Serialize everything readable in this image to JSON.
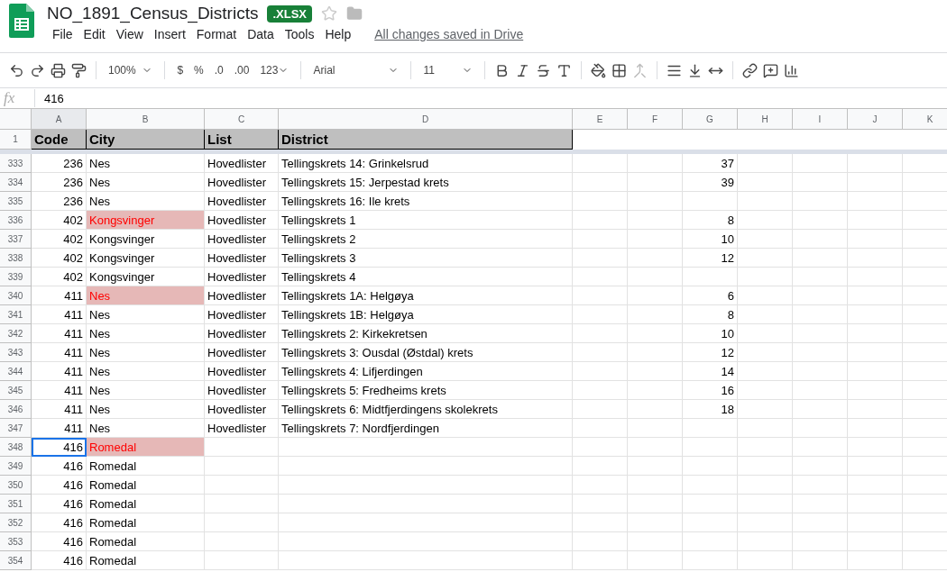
{
  "document": {
    "title": "NO_1891_Census_Districts",
    "badge": ".XLSX",
    "starred": false
  },
  "menu": [
    "File",
    "Edit",
    "View",
    "Insert",
    "Format",
    "Data",
    "Tools",
    "Help"
  ],
  "save_status": "All changes saved in Drive",
  "toolbar": {
    "zoom": "100%",
    "currency": "$",
    "percent": "%",
    "decrease_decimals": ".0",
    "increase_decimals": ".00",
    "number_format": "123",
    "font": "Arial",
    "font_size": "11"
  },
  "formula_bar": {
    "label": "fx",
    "value": "416"
  },
  "columns": [
    {
      "label": "A",
      "selected": true
    },
    {
      "label": "B",
      "selected": false
    },
    {
      "label": "C",
      "selected": false
    },
    {
      "label": "D",
      "selected": false
    },
    {
      "label": "E",
      "selected": false
    },
    {
      "label": "F",
      "selected": false
    },
    {
      "label": "G",
      "selected": false
    },
    {
      "label": "H",
      "selected": false
    },
    {
      "label": "I",
      "selected": false
    },
    {
      "label": "J",
      "selected": false
    },
    {
      "label": "K",
      "selected": false
    }
  ],
  "header_row": {
    "number": "1",
    "cells": [
      "Code",
      "City",
      "List",
      "District"
    ]
  },
  "rows": [
    {
      "number": "333",
      "code": "236",
      "city": "Nes",
      "list": "Hovedlister",
      "district": "Tellingskrets 14: Grinkelsrud",
      "column_g": "37",
      "highlighted": false,
      "selected": false
    },
    {
      "number": "334",
      "code": "236",
      "city": "Nes",
      "list": "Hovedlister",
      "district": "Tellingskrets 15: Jerpestad krets",
      "column_g": "39",
      "highlighted": false,
      "selected": false
    },
    {
      "number": "335",
      "code": "236",
      "city": "Nes",
      "list": "Hovedlister",
      "district": "Tellingskrets 16: Ile krets",
      "highlighted": false,
      "selected": false
    },
    {
      "number": "336",
      "code": "402",
      "city": "Kongsvinger",
      "list": "Hovedlister",
      "district": "Tellingskrets 1",
      "column_g": "8",
      "highlighted": true,
      "selected": false
    },
    {
      "number": "337",
      "code": "402",
      "city": "Kongsvinger",
      "list": "Hovedlister",
      "district": "Tellingskrets 2",
      "column_g": "10",
      "highlighted": false,
      "selected": false
    },
    {
      "number": "338",
      "code": "402",
      "city": "Kongsvinger",
      "list": "Hovedlister",
      "district": "Tellingskrets 3",
      "column_g": "12",
      "highlighted": false,
      "selected": false
    },
    {
      "number": "339",
      "code": "402",
      "city": "Kongsvinger",
      "list": "Hovedlister",
      "district": "Tellingskrets 4",
      "highlighted": false,
      "selected": false
    },
    {
      "number": "340",
      "code": "411",
      "city": "Nes",
      "list": "Hovedlister",
      "district": "Tellingskrets 1A: Helgøya",
      "column_g": "6",
      "highlighted": true,
      "selected": false
    },
    {
      "number": "341",
      "code": "411",
      "city": "Nes",
      "list": "Hovedlister",
      "district": "Tellingskrets 1B: Helgøya",
      "column_g": "8",
      "highlighted": false,
      "selected": false
    },
    {
      "number": "342",
      "code": "411",
      "city": "Nes",
      "list": "Hovedlister",
      "district": "Tellingskrets 2: Kirkekretsen",
      "column_g": "10",
      "highlighted": false,
      "selected": false
    },
    {
      "number": "343",
      "code": "411",
      "city": "Nes",
      "list": "Hovedlister",
      "district": "Tellingskrets 3: Ousdal (Østdal) krets",
      "column_g": "12",
      "highlighted": false,
      "selected": false
    },
    {
      "number": "344",
      "code": "411",
      "city": "Nes",
      "list": "Hovedlister",
      "district": "Tellingskrets 4: Lifjerdingen",
      "column_g": "14",
      "highlighted": false,
      "selected": false
    },
    {
      "number": "345",
      "code": "411",
      "city": "Nes",
      "list": "Hovedlister",
      "district": "Tellingskrets 5: Fredheims krets",
      "column_g": "16",
      "highlighted": false,
      "selected": false
    },
    {
      "number": "346",
      "code": "411",
      "city": "Nes",
      "list": "Hovedlister",
      "district": "Tellingskrets 6: Midtfjerdingens skolekrets",
      "column_g": "18",
      "highlighted": false,
      "selected": false
    },
    {
      "number": "347",
      "code": "411",
      "city": "Nes",
      "list": "Hovedlister",
      "district": "Tellingskrets 7: Nordfjerdingen",
      "highlighted": false,
      "selected": false
    },
    {
      "number": "348",
      "code": "416",
      "city": "Romedal",
      "highlighted": true,
      "selected": true
    },
    {
      "number": "349",
      "code": "416",
      "city": "Romedal",
      "highlighted": false,
      "selected": false
    },
    {
      "number": "350",
      "code": "416",
      "city": "Romedal",
      "highlighted": false,
      "selected": false
    },
    {
      "number": "351",
      "code": "416",
      "city": "Romedal",
      "highlighted": false,
      "selected": false
    },
    {
      "number": "352",
      "code": "416",
      "city": "Romedal",
      "highlighted": false,
      "selected": false
    },
    {
      "number": "353",
      "code": "416",
      "city": "Romedal",
      "highlighted": false,
      "selected": false
    },
    {
      "number": "354",
      "code": "416",
      "city": "Romedal",
      "highlighted": false,
      "selected": false
    }
  ]
}
